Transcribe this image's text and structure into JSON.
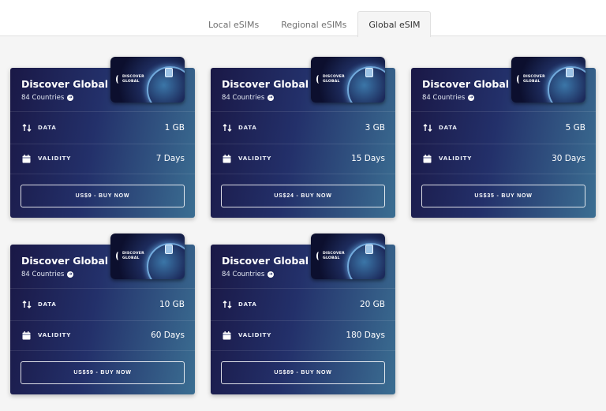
{
  "tabs": [
    {
      "label": "Local eSIMs",
      "active": false
    },
    {
      "label": "Regional eSIMs",
      "active": false
    },
    {
      "label": "Global eSIM",
      "active": true
    }
  ],
  "sim_logo": {
    "text": "DISCOVER GLOBAL"
  },
  "labels": {
    "data": "DATA",
    "validity": "VALIDITY"
  },
  "cards": [
    {
      "title": "Discover Global",
      "countries": "84 Countries",
      "data": "1 GB",
      "validity": "7 Days",
      "button": "US$9 - BUY NOW"
    },
    {
      "title": "Discover Global",
      "countries": "84 Countries",
      "data": "3 GB",
      "validity": "15 Days",
      "button": "US$24 - BUY NOW"
    },
    {
      "title": "Discover Global",
      "countries": "84 Countries",
      "data": "5 GB",
      "validity": "30 Days",
      "button": "US$35 - BUY NOW"
    },
    {
      "title": "Discover Global",
      "countries": "84 Countries",
      "data": "10 GB",
      "validity": "60 Days",
      "button": "US$59 - BUY NOW"
    },
    {
      "title": "Discover Global",
      "countries": "84 Countries",
      "data": "20 GB",
      "validity": "180 Days",
      "button": "US$89 - BUY NOW"
    }
  ],
  "icons": {
    "data": "up-down-arrows-icon",
    "validity": "calendar-icon",
    "countries": "arrow-right-circle-icon"
  },
  "colors": {
    "card_gradient_start": "#1a1846",
    "card_gradient_end": "#3b6e92",
    "page_background": "#f5f5f5"
  }
}
